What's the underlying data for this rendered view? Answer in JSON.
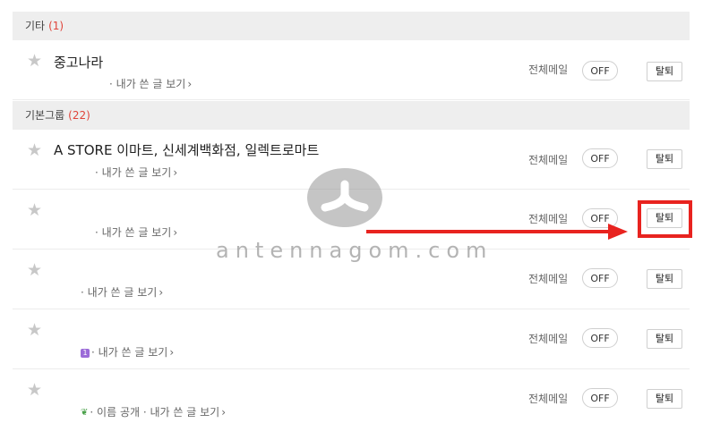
{
  "sections": [
    {
      "title": "기타",
      "count": "(1)"
    },
    {
      "title": "기본그룹",
      "count": "(22)"
    }
  ],
  "star_glyph": "★",
  "mail_label": "전체메일",
  "toggle_label": "OFF",
  "leave_label": "탈퇴",
  "my_posts_link": "내가 쓴 글 보기",
  "name_public": "이름 공개",
  "bullet": "·",
  "chevron": "›",
  "rows": [
    {
      "cafe_name": "중고나라"
    },
    {
      "cafe_name": "A STORE 이마트, 신세계백화점, 일렉트로마트"
    },
    {
      "cafe_name": ""
    },
    {
      "cafe_name": ""
    },
    {
      "cafe_name": ""
    },
    {
      "cafe_name": ""
    }
  ],
  "watermark": "antennagom.com",
  "colors": {
    "highlight": "#e8231f",
    "count": "#e0443a",
    "header_bg": "#eeeeee"
  },
  "icons": [
    "star-icon",
    "chevron-right-icon",
    "level-badge-icon",
    "sprout-icon",
    "arrow-right-icon"
  ]
}
